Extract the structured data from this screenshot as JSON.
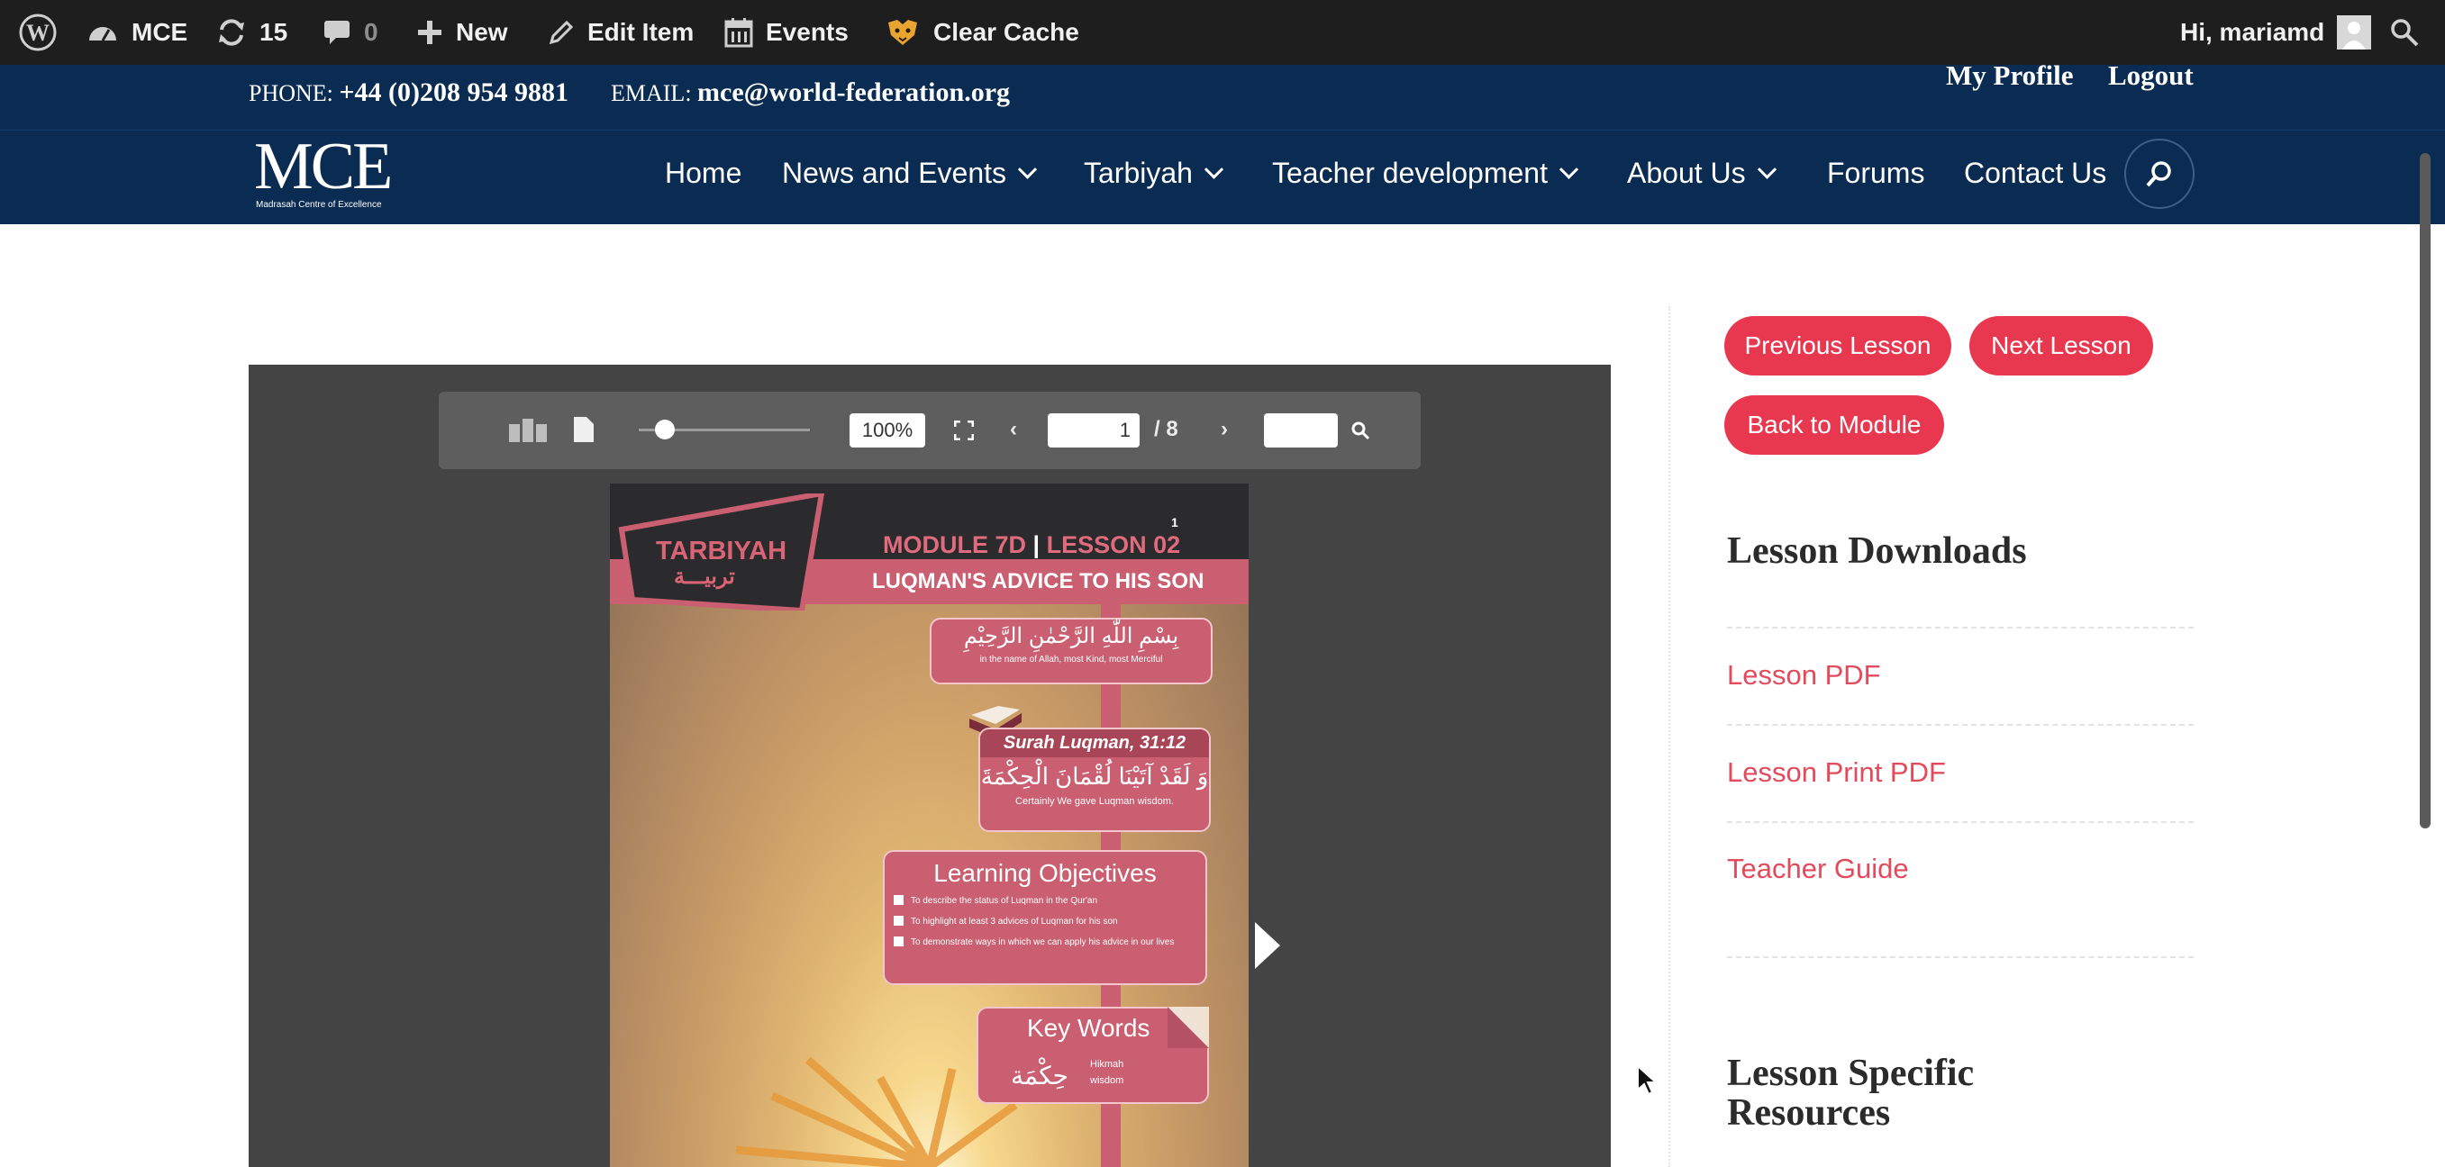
{
  "admin_bar": {
    "site": "MCE",
    "updates_count": "15",
    "comments_count": "0",
    "new_label": "New",
    "edit_label": "Edit Item",
    "events_label": "Events",
    "cache_label": "Clear Cache",
    "greeting": "Hi, mariamd"
  },
  "topbar": {
    "phone_label": "PHONE:",
    "phone": "+44 (0)208 954 9881",
    "email_label": "EMAIL:",
    "email": "mce@world-federation.org",
    "profile_link": "My Profile",
    "logout_link": "Logout"
  },
  "logo": {
    "text": "MCE",
    "tagline": "Madrasah Centre of Excellence"
  },
  "nav": {
    "home": "Home",
    "news": "News and Events",
    "tarbiyah": "Tarbiyah",
    "teacher": "Teacher development",
    "about": "About Us",
    "forums": "Forums",
    "contact": "Contact Us"
  },
  "viewer": {
    "zoom": "100%",
    "current_page": "1",
    "total_pages": "/ 8",
    "zoom_slider_fraction": 0.15
  },
  "lesson_page": {
    "page_number": "1",
    "badge_en": "TARBIYAH",
    "badge_ar": "تربيـــة",
    "module": "MODULE 7D",
    "separator": "|",
    "lesson": "LESSON 02",
    "subtitle": "LUQMAN'S ADVICE TO HIS SON",
    "bismillah_ar": "بِسْمِ اللّٰهِ الرَّحْمٰنِ الرَّحِيْمِ",
    "bismillah_en": "in the name of Allah, most Kind, most Merciful",
    "surah_ref": "Surah Luqman, 31:12",
    "verse_ar": "وَ لَقَدْ آتَيْنَا لُقْمَانَ الْحِكْمَةَ",
    "verse_en": "Certainly We gave Luqman wisdom.",
    "objectives_title": "Learning Objectives",
    "objectives": [
      "To describe the status of Luqman in the Qur'an",
      "To highlight at least 3 advices of Luqman for his son",
      "To demonstrate ways in which we can apply his advice in our lives"
    ],
    "keywords_title": "Key Words",
    "keyword_ar": "حِكْمَة",
    "keyword_translit": "Hikmah",
    "keyword_en": "wisdom"
  },
  "sidebar": {
    "prev_button": "Previous Lesson",
    "next_button": "Next Lesson",
    "back_button": "Back to Module",
    "downloads_heading": "Lesson Downloads",
    "downloads": [
      "Lesson PDF",
      "Lesson Print PDF",
      "Teacher Guide"
    ],
    "resources_heading_1": "Lesson Specific",
    "resources_heading_2": "Resources"
  },
  "colors": {
    "admin_bar": "#1e1e1e",
    "navy": "#0b2c52",
    "accent_red": "#e8384f",
    "link_red": "#e34b5c",
    "page_pink": "#c95f70"
  }
}
